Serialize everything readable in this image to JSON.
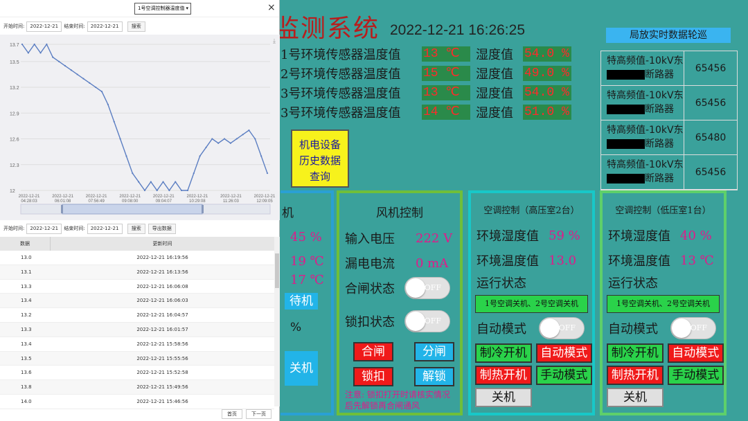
{
  "dashboard": {
    "title": "监测系统",
    "datetime": "2022-12-21 16:26:25",
    "pd_button": "局放实时数据轮巡",
    "sensors": [
      {
        "label": "1号环境传感器温度值",
        "temp": "13 ℃",
        "hum_label": "湿度值",
        "hum": "54.0 %"
      },
      {
        "label": "2号环境传感器温度值",
        "temp": "15 ℃",
        "hum_label": "湿度值",
        "hum": "49.0 %"
      },
      {
        "label": "3号环境传感器温度值",
        "temp": "13 ℃",
        "hum_label": "湿度值",
        "hum": "54.0 %"
      },
      {
        "label": "3号环境传感器温度值",
        "temp": "14 ℃",
        "hum_label": "湿度值",
        "hum": "51.0 %"
      }
    ],
    "history_button": [
      "机电设备",
      "历史数据",
      "查询"
    ],
    "pd_table": [
      {
        "line1": "特高频值-10kV东",
        "line2": "断路器",
        "value": "65456"
      },
      {
        "line1": "特高频值-10kV东",
        "line2": "断路器",
        "value": "65456"
      },
      {
        "line1": "特高频值-10kV东",
        "line2": "断路器",
        "value": "65480"
      },
      {
        "line1": "特高频值-10kV东",
        "line2": "断路器",
        "value": "65456"
      }
    ],
    "left_panel": {
      "title": "机",
      "v1": "45 %",
      "v2": "19 ℃",
      "v3": "17 ℃",
      "standby": "待机",
      "pct": "%",
      "off": "关机"
    },
    "fan": {
      "title": "风机控制",
      "voltage_label": "输入电压",
      "voltage": "222 V",
      "leak_label": "漏电电流",
      "leak": "0 mA",
      "close_label": "合闸状态",
      "lock_label": "锁扣状态",
      "toggle_off": "OFF",
      "btn_close": "合闸",
      "btn_open": "分闸",
      "btn_lock": "锁扣",
      "btn_unlock": "解锁",
      "note": "注意: 锁扣打开时请核实情况后先解锁再合闸通风"
    },
    "ac_high": {
      "title": "空调控制（高压室2台）",
      "hum_label": "环境湿度值",
      "hum": "59 %",
      "temp_label": "环境温度值",
      "temp": "13.0",
      "run_label": "运行状态",
      "status": "1号空调关机、2号空调关机",
      "auto_label": "自动模式",
      "toggle_off": "OFF",
      "cool": "制冷开机",
      "auto": "自动模式",
      "heat": "制热开机",
      "manual": "手动模式",
      "off": "关机"
    },
    "ac_low": {
      "title": "空调控制（低压室1台）",
      "hum_label": "环境湿度值",
      "hum": "40 %",
      "temp_label": "环境温度值",
      "temp": "13 ℃",
      "run_label": "运行状态",
      "status": "1号空调关机、2号空调关机",
      "auto_label": "自动模式",
      "toggle_off": "OFF",
      "cool": "制冷开机",
      "auto": "自动模式",
      "heat": "制热开机",
      "manual": "手动模式",
      "off": "关机"
    }
  },
  "popup": {
    "select_value": "1号空调控制器温度值",
    "close": "×",
    "start_label": "开始时间:",
    "end_label": "结束时间:",
    "start_date": "2022-12-21",
    "end_date": "2022-12-21",
    "search": "搜索",
    "export": "导出数据",
    "col_data": "数据",
    "col_time": "更新时间",
    "rows": [
      {
        "v": "13.0",
        "t": "2022-12-21 16:19:56"
      },
      {
        "v": "13.1",
        "t": "2022-12-21 16:13:56"
      },
      {
        "v": "13.3",
        "t": "2022-12-21 16:06:08"
      },
      {
        "v": "13.4",
        "t": "2022-12-21 16:06:03"
      },
      {
        "v": "13.2",
        "t": "2022-12-21 16:04:57"
      },
      {
        "v": "13.3",
        "t": "2022-12-21 16:01:57"
      },
      {
        "v": "13.4",
        "t": "2022-12-21 15:58:56"
      },
      {
        "v": "13.5",
        "t": "2022-12-21 15:55:56"
      },
      {
        "v": "13.6",
        "t": "2022-12-21 15:52:58"
      },
      {
        "v": "13.8",
        "t": "2022-12-21 15:49:56"
      },
      {
        "v": "14.0",
        "t": "2022-12-21 15:46:56"
      }
    ],
    "first_page": "首页",
    "next_page": "下一页"
  },
  "chart_data": {
    "type": "line",
    "ylim": [
      12,
      13.7
    ],
    "yticks": [
      "13.7",
      "13.5",
      "13.2",
      "12.9",
      "12.6",
      "12.3",
      "12"
    ],
    "xticks": [
      "2022-12-21 04:28:03",
      "2022-12-21 06:01:08",
      "2022-12-21 07:56:49",
      "2022-12-21 09:08:00",
      "2022-12-21 09:04:07",
      "2022-12-21 10:29:08",
      "2022-12-21 11:26:03",
      "2022-12-21 12:09:05"
    ],
    "series": [
      {
        "values": [
          13.7,
          13.6,
          13.7,
          13.6,
          13.7,
          13.55,
          13.5,
          13.45,
          13.4,
          13.35,
          13.3,
          13.25,
          13.2,
          13.15,
          13.0,
          12.8,
          12.6,
          12.4,
          12.2,
          12.1,
          12.0,
          12.1,
          12.0,
          12.1,
          12.0,
          12.1,
          12.0,
          12.0,
          12.2,
          12.4,
          12.5,
          12.6,
          12.55,
          12.6,
          12.55,
          12.6,
          12.65,
          12.7,
          12.6,
          12.4,
          12.2
        ]
      }
    ]
  }
}
